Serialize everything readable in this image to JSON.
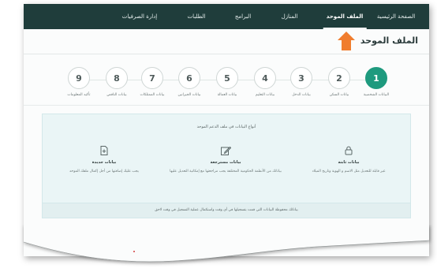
{
  "nav": {
    "items": [
      {
        "label": "الصفحة الرئيسية",
        "active": false
      },
      {
        "label": "الملف الموحد",
        "active": true
      },
      {
        "label": "المنازل",
        "active": false
      },
      {
        "label": "البرامج",
        "active": false
      },
      {
        "label": "الطلبات",
        "active": false
      },
      {
        "label": "إدارة الصرفيات",
        "active": false
      }
    ]
  },
  "page": {
    "title": "الملف الموحد"
  },
  "steps": [
    {
      "number": "1",
      "label": "البيانات الشخصية",
      "active": true
    },
    {
      "number": "2",
      "label": "بيانات السكن",
      "active": false
    },
    {
      "number": "3",
      "label": "بيانات الدخل",
      "active": false
    },
    {
      "number": "4",
      "label": "بيانات التعليم",
      "active": false
    },
    {
      "number": "5",
      "label": "بيانات العمالة",
      "active": false
    },
    {
      "number": "6",
      "label": "بيانات الجيرانين",
      "active": false
    },
    {
      "number": "7",
      "label": "بيانات الممتلكات",
      "active": false
    },
    {
      "number": "8",
      "label": "بيانات الناقص",
      "active": false
    },
    {
      "number": "9",
      "label": "تأكيد المعلومات",
      "active": false
    }
  ],
  "info_box": {
    "title": "أنواع البيانات في ملف الدعم الموحد",
    "columns": [
      {
        "icon": "lock-icon",
        "title": "بيانات ثابتة",
        "description": "غير قابلة للتعديل مثل الاسم و الهوية وتاريخ الميلاد"
      },
      {
        "icon": "edit-icon",
        "title": "بيانات مسترجعة",
        "description": "بياناتك من الأنظمة الحكومية المختلفة يجب مراجعتها مع إمكانية التعديل عليها"
      },
      {
        "icon": "add-document-icon",
        "title": "بيانات جديدة",
        "description": "يجب عليك إضافتها من أجل إكمال ملفك الموحد"
      }
    ],
    "note": "بياناتك محفوظة البيانات التي قمت بتسجيلها في أي وقت واستكمال عملية التسجيل في وقت لاحق"
  },
  "colors": {
    "navbar": "#1f3d3b",
    "accent": "#1e9a7e",
    "arrow": "#f07d2e"
  }
}
